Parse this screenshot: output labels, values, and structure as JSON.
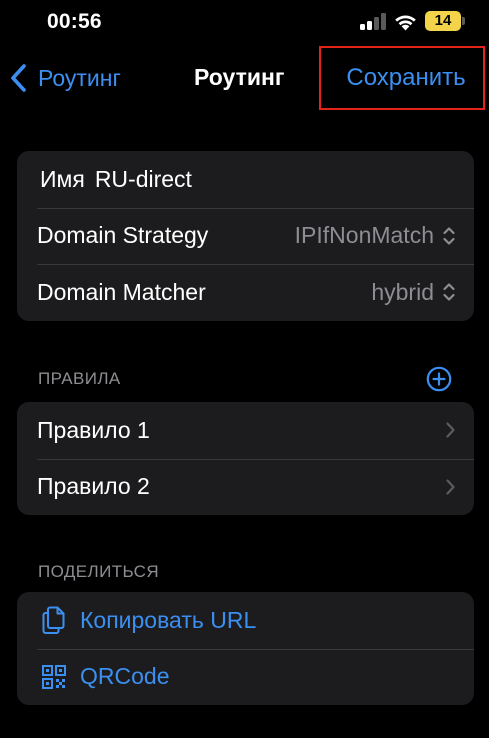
{
  "status_bar": {
    "time": "00:56",
    "battery": "14"
  },
  "nav": {
    "back_label": "Роутинг",
    "title": "Роутинг",
    "save_label": "Сохранить"
  },
  "settings": {
    "name_label": "Имя",
    "name_value": "RU-direct",
    "domain_strategy_label": "Domain Strategy",
    "domain_strategy_value": "IPIfNonMatch",
    "domain_matcher_label": "Domain Matcher",
    "domain_matcher_value": "hybrid"
  },
  "rules": {
    "header": "ПРАВИЛА",
    "items": [
      {
        "label": "Правило 1"
      },
      {
        "label": "Правило 2"
      }
    ]
  },
  "share": {
    "header": "ПОДЕЛИТЬСЯ",
    "copy_url_label": "Копировать URL",
    "qrcode_label": "QRCode"
  },
  "colors": {
    "accent": "#3b8ff0",
    "background": "#000000",
    "group_background": "#1c1c1e",
    "secondary_text": "#8d8d92",
    "highlight_border": "#e4231a",
    "battery": "#f2d34a"
  },
  "icons": [
    "back-chevron-icon",
    "cellular-signal-icon",
    "wifi-icon",
    "battery-icon",
    "up-down-chevron-icon",
    "add-circle-icon",
    "chevron-right-icon",
    "copy-document-icon",
    "qrcode-icon"
  ]
}
